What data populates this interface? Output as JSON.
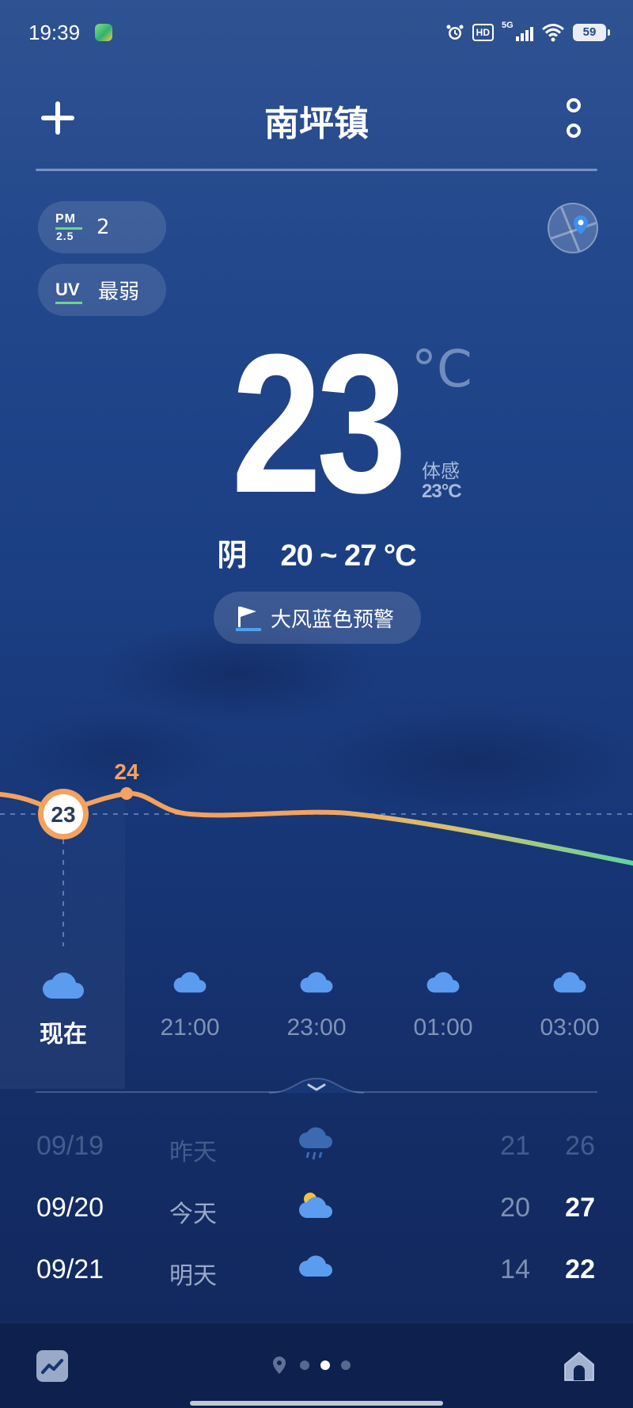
{
  "status_bar": {
    "time": "19:39",
    "hd": "HD",
    "network": "5G",
    "battery": "59"
  },
  "header": {
    "city": "南坪镇"
  },
  "air": {
    "pm_top": "PM",
    "pm_bottom": "2.5",
    "pm_value": "2",
    "uv_label": "UV",
    "uv_value": "最弱"
  },
  "current": {
    "temp": "23",
    "unit": "°C",
    "feels_label": "体感",
    "feels_value": "23°C",
    "condition": "阴",
    "range": "20 ~ 27 °C",
    "alert": "大风蓝色预警"
  },
  "chart_data": {
    "type": "line",
    "x": [
      "现在",
      "21:00",
      "23:00",
      "01:00",
      "03:00"
    ],
    "labels": {
      "now": "23",
      "peak": "24"
    }
  },
  "hourly": [
    {
      "label": "现在",
      "icon": "cloud-icon"
    },
    {
      "label": "21:00",
      "icon": "cloud-icon"
    },
    {
      "label": "23:00",
      "icon": "cloud-icon"
    },
    {
      "label": "01:00",
      "icon": "cloud-icon"
    },
    {
      "label": "03:00",
      "icon": "cloud-icon"
    }
  ],
  "daily": [
    {
      "date": "09/19",
      "name": "昨天",
      "icon": "rain-cloud-icon",
      "low": "21",
      "high": "26"
    },
    {
      "date": "09/20",
      "name": "今天",
      "icon": "partly-cloudy-icon",
      "low": "20",
      "high": "27"
    },
    {
      "date": "09/21",
      "name": "明天",
      "icon": "cloud-icon",
      "low": "14",
      "high": "22"
    }
  ],
  "colors": {
    "accent_orange": "#f4a25e",
    "accent_green": "#5fd4a0",
    "icon_blue": "#5b9cf0"
  }
}
